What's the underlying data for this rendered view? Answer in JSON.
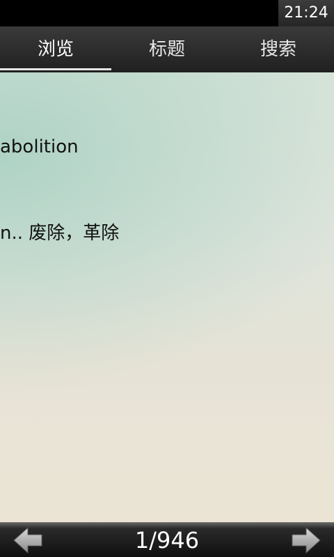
{
  "status_bar": {
    "time": "21:24"
  },
  "tabs": [
    {
      "label": "浏览",
      "active": true
    },
    {
      "label": "标题",
      "active": false
    },
    {
      "label": "搜索",
      "active": false
    }
  ],
  "entry": {
    "word": "abolition",
    "definition": "n.. 废除，革除"
  },
  "pager": {
    "page": "1/946",
    "prev_icon": "left-arrow-icon",
    "next_icon": "right-arrow-icon"
  },
  "colors": {
    "tab_bar": "#2c2c2c",
    "indicator": "#e6e6e6",
    "content_bg": "#e6e3d6",
    "text": "#111111"
  }
}
